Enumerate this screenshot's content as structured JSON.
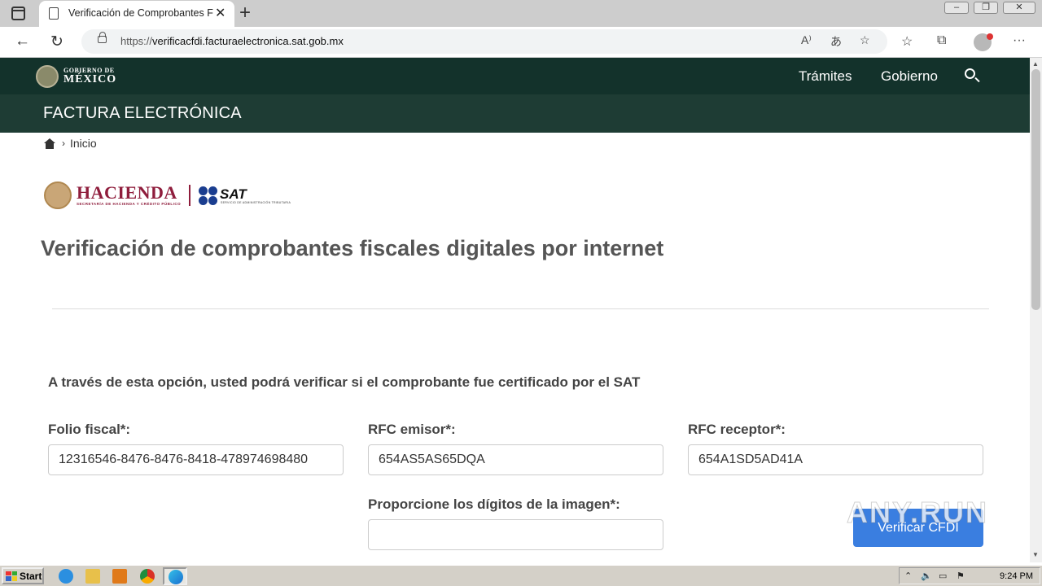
{
  "browser": {
    "tab_title": "Verificación de Comprobantes Fiscales",
    "url_host": "verificacfdi.facturaelectronica.sat.gob.mx",
    "url_scheme": "https://"
  },
  "header": {
    "gob_line1": "GOBIERNO DE",
    "gob_line2": "MÉXICO",
    "nav": [
      "Trámites",
      "Gobierno"
    ],
    "section_title": "FACTURA ELECTRÓNICA"
  },
  "breadcrumb": {
    "current": "Inicio"
  },
  "logos": {
    "hacienda": "HACIENDA",
    "hacienda_sub": "SECRETARÍA DE HACIENDA Y CRÉDITO PÚBLICO",
    "sat": "SAT",
    "sat_sub": "SERVICIO DE ADMINISTRACIÓN TRIBUTARIA"
  },
  "main": {
    "title": "Verificación de comprobantes fiscales digitales por internet",
    "intro": "A través de esta opción, usted podrá verificar si el comprobante fue certificado por el SAT"
  },
  "form": {
    "folio_label": "Folio fiscal*:",
    "folio_value": "12316546-8476-8476-8418-478974698480",
    "emisor_label": "RFC emisor*:",
    "emisor_value": "654AS5AS65DQA",
    "receptor_label": "RFC receptor*:",
    "receptor_value": "654A1SD5AD41A",
    "captcha_label": "Proporcione los dígitos de la imagen*:",
    "captcha_value": "",
    "submit_label": "Verificar CFDI"
  },
  "watermark": "ANY.RUN",
  "taskbar": {
    "start_label": "Start",
    "clock": "9:24 PM"
  },
  "colors": {
    "gob_dark": "#13322b",
    "gob_band": "#1e3c34",
    "hacienda": "#8f1d3c",
    "button": "#3a7ee0"
  }
}
